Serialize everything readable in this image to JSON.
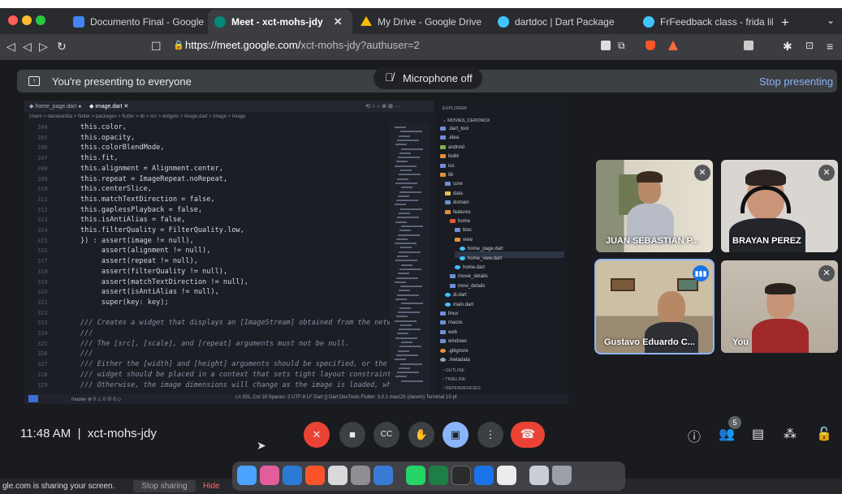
{
  "browser": {
    "tabs": [
      {
        "title": "Documento Final - Google Docs",
        "icon": "google-docs-icon",
        "color": "#4285f4"
      },
      {
        "title": "Meet - xct-mohs-jdy",
        "icon": "meet-icon",
        "color": "#00897b",
        "active": true
      },
      {
        "title": "My Drive - Google Drive",
        "icon": "drive-icon",
        "color": "#fbbc04"
      },
      {
        "title": "dartdoc | Dart Package",
        "icon": "dart-icon",
        "color": "#40c4ff"
      },
      {
        "title": "FrFeedback class - frida library",
        "icon": "dart-icon",
        "color": "#40c4ff"
      }
    ],
    "url_host": "https://meet.google.com/",
    "url_path": "xct-mohs-jdy?authuser=2"
  },
  "meet": {
    "banner_text": "You're presenting to everyone",
    "stop_presenting": "Stop presenting",
    "mic_off_label": "Microphone off",
    "time": "11:48 AM",
    "meeting_code": "xct-mohs-jdy",
    "participants_count": "5",
    "accent": "#8ab4f8",
    "danger": "#ea4335",
    "participants": [
      {
        "name": "JUAN SEBASTIAN P...",
        "muted": true
      },
      {
        "name": "BRAYAN PEREZ",
        "muted": true
      },
      {
        "name": "Gustavo Eduardo C...",
        "speaking": true
      },
      {
        "name": "You",
        "muted": true
      }
    ]
  },
  "editor": {
    "tabs": [
      "home_page.dart",
      "image.dart"
    ],
    "breadcrumb": "Users > danielardila > flutter > packages > flutter > lib > src > widgets > image.dart > Image > Image",
    "code_lines": [
      {
        "ln": "304",
        "text": "this.color,"
      },
      {
        "ln": "305",
        "text": "this.opacity,"
      },
      {
        "ln": "306",
        "text": "this.colorBlendMode,"
      },
      {
        "ln": "307",
        "text": "this.fit,"
      },
      {
        "ln": "308",
        "text": "this.alignment = Alignment.center,"
      },
      {
        "ln": "309",
        "text": "this.repeat = ImageRepeat.noRepeat,"
      },
      {
        "ln": "310",
        "text": "this.centerSlice,"
      },
      {
        "ln": "311",
        "text": "this.matchTextDirection = false,"
      },
      {
        "ln": "312",
        "text": "this.gaplessPlayback = false,"
      },
      {
        "ln": "313",
        "text": "this.isAntiAlias = false,"
      },
      {
        "ln": "314",
        "text": "this.filterQuality = FilterQuality.low,"
      },
      {
        "ln": "315",
        "text": "}) : assert(image != null),"
      },
      {
        "ln": "316",
        "text": "     assert(alignment != null),"
      },
      {
        "ln": "317",
        "text": "     assert(repeat != null),"
      },
      {
        "ln": "318",
        "text": "     assert(filterQuality != null),"
      },
      {
        "ln": "319",
        "text": "     assert(matchTextDirection != null),"
      },
      {
        "ln": "320",
        "text": "     assert(isAntiAlias != null),"
      },
      {
        "ln": "321",
        "text": "     super(key: key);"
      },
      {
        "ln": "322",
        "text": ""
      },
      {
        "ln": "323",
        "text": "/// Creates a widget that displays an [ImageStream] obtained from the networ"
      },
      {
        "ln": "324",
        "text": "///"
      },
      {
        "ln": "325",
        "text": "/// The [src], [scale], and [repeat] arguments must not be null."
      },
      {
        "ln": "326",
        "text": "///"
      },
      {
        "ln": "327",
        "text": "/// Either the [width] and [height] arguments should be specified, or the"
      },
      {
        "ln": "328",
        "text": "/// widget should be placed in a context that sets tight layout constraints"
      },
      {
        "ln": "329",
        "text": "/// Otherwise, the image dimensions will change as the image is loaded, whi"
      }
    ],
    "explorer_title": "EXPLORER",
    "project": "MOVIES_CERONOX",
    "files": [
      {
        "name": ".dart_tool",
        "kind": "folder"
      },
      {
        "name": ".idea",
        "kind": "folder"
      },
      {
        "name": "android",
        "kind": "folder"
      },
      {
        "name": "build",
        "kind": "folder"
      },
      {
        "name": "ios",
        "kind": "folder"
      },
      {
        "name": "lib",
        "kind": "folder"
      },
      {
        "name": "core",
        "kind": "folder"
      },
      {
        "name": "data",
        "kind": "folder"
      },
      {
        "name": "domain",
        "kind": "folder"
      },
      {
        "name": "features",
        "kind": "folder"
      },
      {
        "name": "home",
        "kind": "folder"
      },
      {
        "name": "bloc",
        "kind": "folder"
      },
      {
        "name": "view",
        "kind": "folder"
      },
      {
        "name": "home_page.dart",
        "kind": "file"
      },
      {
        "name": "home_view.dart",
        "kind": "file"
      },
      {
        "name": "home.dart",
        "kind": "file"
      },
      {
        "name": "movie_details",
        "kind": "folder"
      },
      {
        "name": "movi_details",
        "kind": "folder"
      },
      {
        "name": "di.dart",
        "kind": "file"
      },
      {
        "name": "main.dart",
        "kind": "file"
      },
      {
        "name": "linux",
        "kind": "folder"
      },
      {
        "name": "macos",
        "kind": "folder"
      },
      {
        "name": "web",
        "kind": "folder"
      },
      {
        "name": "windows",
        "kind": "folder"
      },
      {
        "name": ".gitignore",
        "kind": "file"
      },
      {
        "name": ".metadata",
        "kind": "file"
      }
    ],
    "outline": "OUTLINE",
    "timeline": "TIMELINE",
    "dependencies": "DEPENDENCIES",
    "status_left": "master  ⊗ 0 ⚠ 0  ⓪ 0 ◇",
    "status_mid": "Ln 331, Col 16   Spaces: 2   UTF-8   LF   Dart   {}   Dart DevTools   Flutter: 3.0.1   macOS (darwin)   Terminal 15-pt"
  },
  "system": {
    "share_text": "gle.com is sharing your screen.",
    "stop_sharing": "Stop sharing",
    "hide": "Hide"
  }
}
